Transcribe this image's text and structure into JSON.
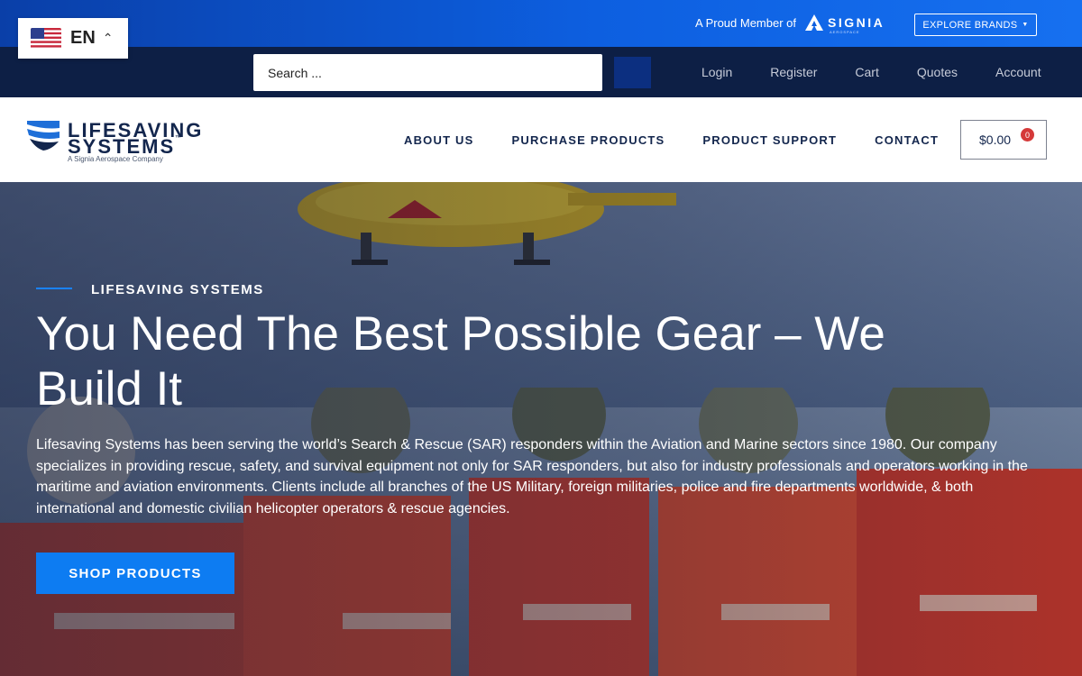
{
  "language": {
    "code": "EN",
    "flag": "us-flag-icon"
  },
  "topbar": {
    "member_text": "A Proud Member of",
    "signia_logo": "SIGNIA",
    "signia_sub": "AEROSPACE",
    "explore_label": "EXPLORE BRANDS"
  },
  "search": {
    "placeholder": "Search ..."
  },
  "account_links": [
    "Login",
    "Register",
    "Cart",
    "Quotes",
    "Account"
  ],
  "logo": {
    "line1": "LIFESAVING",
    "line2": "SYSTEMS",
    "tm": "™",
    "tagline": "A Signia Aerospace Company"
  },
  "nav": [
    "ABOUT US",
    "PURCHASE PRODUCTS",
    "PRODUCT SUPPORT",
    "CONTACT"
  ],
  "cart": {
    "total": "$0.00",
    "count": "0"
  },
  "hero": {
    "eyebrow": "LIFESAVING SYSTEMS",
    "title": "You Need The Best Possible Gear – We Build It",
    "description": "Lifesaving Systems has been serving the world’s Search & Rescue (SAR) responders within the Aviation and Marine sectors since 1980. Our company specializes in providing rescue, safety, and survival equipment not only for SAR responders, but also for industry professionals and operators working in the maritime and aviation environments. Clients include all branches of the US Military, foreign militaries, police and fire departments worldwide, & both international and domestic civilian helicopter operators & rescue agencies.",
    "button_label": "SHOP PRODUCTS"
  },
  "colors": {
    "topbar": "#0d5fe0",
    "secbar": "#0d1f45",
    "accent": "#0d7cf2",
    "navy": "#13264d",
    "badge": "#d53939"
  }
}
